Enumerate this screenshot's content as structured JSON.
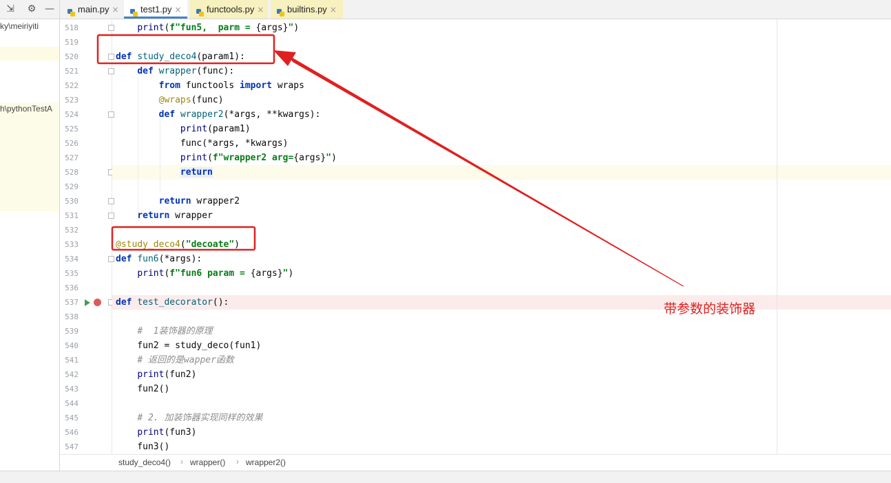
{
  "tabs": [
    {
      "label": "main.py",
      "icon": "python-file-icon"
    },
    {
      "label": "test1.py",
      "icon": "python-file-icon"
    },
    {
      "label": "functools.py",
      "icon": "python-file-icon"
    },
    {
      "label": "builtins.py",
      "icon": "python-file-icon"
    }
  ],
  "tab_close_glyph": "×",
  "project_tree": {
    "item_1": "ky\\meiriyiti",
    "item_2": "h\\pythonTestA"
  },
  "code_lines": [
    {
      "n": "518",
      "html": "    <span class=\"builtin\">print</span>(<span class=\"str\">f\"fun5,  parm = </span>{args}<span class=\"str\">\"</span>)"
    },
    {
      "n": "519",
      "html": ""
    },
    {
      "n": "520",
      "html": "<span class=\"kw\">def</span> <span class=\"fn\">study_deco4</span>(param1):"
    },
    {
      "n": "521",
      "html": "    <span class=\"kw\">def</span> <span class=\"fn\">wrapper</span>(func):"
    },
    {
      "n": "522",
      "html": "        <span class=\"kw\">from</span> functools <span class=\"kw\">import</span> wraps"
    },
    {
      "n": "523",
      "html": "        <span class=\"deco\">@wraps</span>(func)"
    },
    {
      "n": "524",
      "html": "        <span class=\"kw\">def</span> <span class=\"fn\">wrapper2</span>(*args, **kwargs):"
    },
    {
      "n": "525",
      "html": "            <span class=\"builtin\">print</span>(param1)"
    },
    {
      "n": "526",
      "html": "            func(*args, *kwargs)"
    },
    {
      "n": "527",
      "html": "            <span class=\"builtin\">print</span>(<span class=\"str\">f\"wrapper2 arg=</span>{args}<span class=\"str\">\"</span>)"
    },
    {
      "n": "528",
      "html": "            <span class=\"kw ret-hl\">return</span>"
    },
    {
      "n": "529",
      "html": ""
    },
    {
      "n": "530",
      "html": "        <span class=\"kw\">return</span> wrapper2"
    },
    {
      "n": "531",
      "html": "    <span class=\"kw\">return</span> wrapper"
    },
    {
      "n": "532",
      "html": ""
    },
    {
      "n": "533",
      "html": "<span class=\"deco\">@study_deco4</span>(<span class=\"str\">\"decoate\"</span>)"
    },
    {
      "n": "534",
      "html": "<span class=\"kw\">def</span> <span class=\"fn\">fun6</span>(*args):"
    },
    {
      "n": "535",
      "html": "    <span class=\"builtin\">print</span>(<span class=\"str\">f\"fun6 param = </span>{args}<span class=\"str\">\"</span>)"
    },
    {
      "n": "536",
      "html": ""
    },
    {
      "n": "537",
      "html": "<span class=\"kw\">def</span> <span class=\"fn\">test_decorator</span>():"
    },
    {
      "n": "538",
      "html": ""
    },
    {
      "n": "539",
      "html": "    <span class=\"com\">#  1装饰器的原理</span>"
    },
    {
      "n": "540",
      "html": "    fun2 = study_deco(fun1)"
    },
    {
      "n": "541",
      "html": "    <span class=\"com\"># 返回的是wapper函数</span>"
    },
    {
      "n": "542",
      "html": "    <span class=\"builtin\">print</span>(fun2)"
    },
    {
      "n": "543",
      "html": "    fun2()"
    },
    {
      "n": "544",
      "html": ""
    },
    {
      "n": "545",
      "html": "    <span class=\"com\"># 2. 加装饰器实现同样的效果</span>"
    },
    {
      "n": "546",
      "html": "    <span class=\"builtin\">print</span>(fun3)"
    },
    {
      "n": "547",
      "html": "    fun3()"
    }
  ],
  "fold_marker_lines": [
    "518",
    "520",
    "521",
    "524",
    "528",
    "530",
    "531",
    "534",
    "537"
  ],
  "breakpoint_line": "537",
  "run_gutter_line": "537",
  "caret_line": "528",
  "breadcrumb": [
    "study_deco4()",
    "wrapper()",
    "wrapper2()"
  ],
  "breadcrumb_sep": "›",
  "annotation": {
    "text": "带参数的装饰器",
    "color": "#e02020"
  },
  "colors": {
    "keyword": "#0033b3",
    "string": "#067d17",
    "decorator": "#9e880d",
    "comment": "#8c8c8c",
    "breakpoint": "#db5c5c",
    "run_arrow": "#499c54",
    "active_tab_underline": "#4083c9"
  }
}
